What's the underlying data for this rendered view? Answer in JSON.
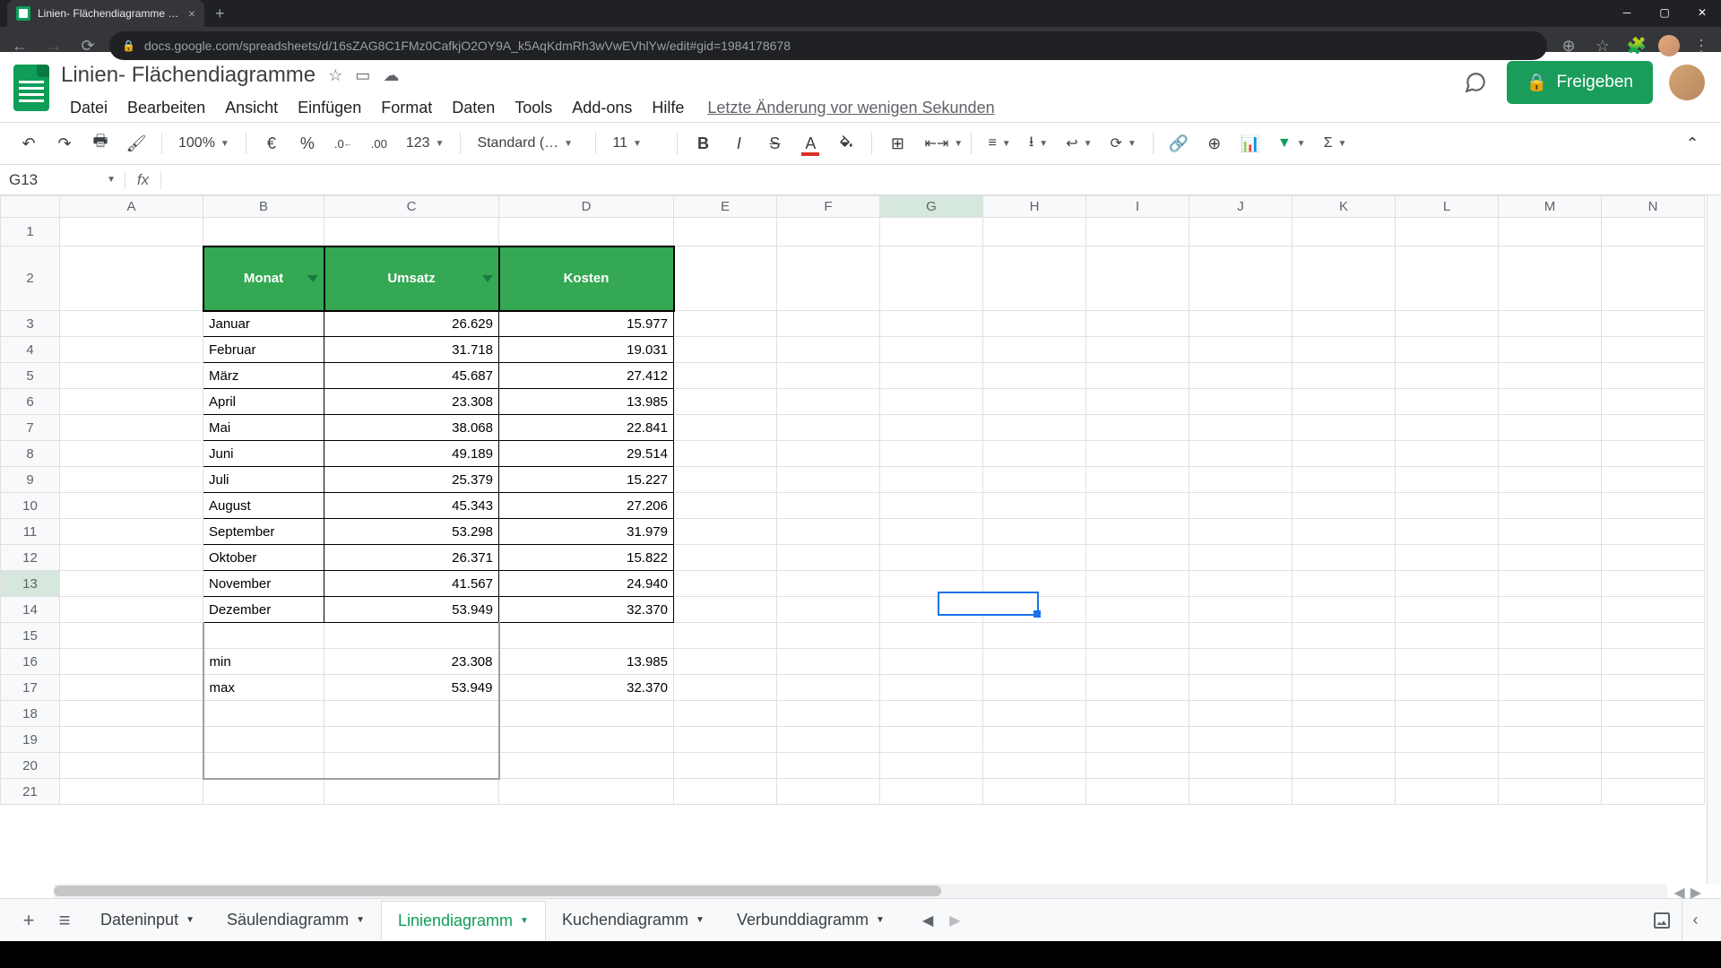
{
  "browser": {
    "tab_title": "Linien- Flächendiagramme - Goo…",
    "url": "docs.google.com/spreadsheets/d/16sZAG8C1FMz0CafkjO2OY9A_k5AqKdmRh3wVwEVhlYw/edit#gid=1984178678"
  },
  "app": {
    "doc_title": "Linien- Flächendiagramme",
    "menus": [
      "Datei",
      "Bearbeiten",
      "Ansicht",
      "Einfügen",
      "Format",
      "Daten",
      "Tools",
      "Add-ons",
      "Hilfe"
    ],
    "last_edit": "Letzte Änderung vor wenigen Sekunden",
    "share_label": "Freigeben"
  },
  "toolbar": {
    "zoom": "100%",
    "currency": "€",
    "percent": "%",
    "dec_less": ".0",
    "dec_more": ".00",
    "num_format": "123",
    "font": "Standard (…",
    "font_size": "11"
  },
  "formula": {
    "name_box": "G13",
    "fx": "fx",
    "value": ""
  },
  "columns": [
    "A",
    "B",
    "C",
    "D",
    "E",
    "F",
    "G",
    "H",
    "I",
    "J",
    "K",
    "L",
    "M",
    "N"
  ],
  "table": {
    "headers": [
      "Monat",
      "Umsatz",
      "Kosten"
    ],
    "rows": [
      {
        "m": "Januar",
        "u": "26.629",
        "k": "15.977"
      },
      {
        "m": "Februar",
        "u": "31.718",
        "k": "19.031"
      },
      {
        "m": "März",
        "u": "45.687",
        "k": "27.412"
      },
      {
        "m": "April",
        "u": "23.308",
        "k": "13.985"
      },
      {
        "m": "Mai",
        "u": "38.068",
        "k": "22.841"
      },
      {
        "m": "Juni",
        "u": "49.189",
        "k": "29.514"
      },
      {
        "m": "Juli",
        "u": "25.379",
        "k": "15.227"
      },
      {
        "m": "August",
        "u": "45.343",
        "k": "27.206"
      },
      {
        "m": "September",
        "u": "53.298",
        "k": "31.979"
      },
      {
        "m": "Oktober",
        "u": "26.371",
        "k": "15.822"
      },
      {
        "m": "November",
        "u": "41.567",
        "k": "24.940"
      },
      {
        "m": "Dezember",
        "u": "53.949",
        "k": "32.370"
      }
    ],
    "stats": [
      {
        "label": "min",
        "u": "23.308",
        "k": "13.985"
      },
      {
        "label": "max",
        "u": "53.949",
        "k": "32.370"
      }
    ]
  },
  "sheets": {
    "tabs": [
      "Dateninput",
      "Säulendiagramm",
      "Liniendiagramm",
      "Kuchendiagramm",
      "Verbunddiagramm"
    ],
    "active_index": 2
  },
  "selected_cell_ref": "G13"
}
